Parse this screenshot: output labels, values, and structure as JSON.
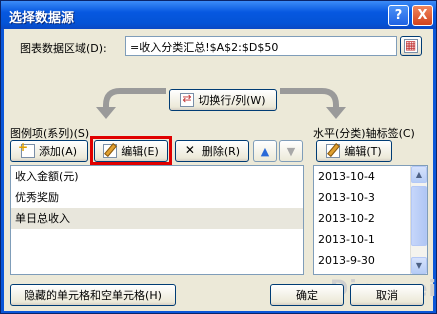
{
  "window": {
    "title": "选择数据源",
    "help_label": "?",
    "close_label": "X"
  },
  "range": {
    "label": "图表数据区域(D):",
    "value": "=收入分类汇总!$A$2:$D$50"
  },
  "switch_button": "切换行/列(W)",
  "series": {
    "label": "图例项(系列)(S)",
    "add_label": "添加(A)",
    "edit_label": "编辑(E)",
    "delete_label": "删除(R)",
    "up_label": "▲",
    "down_label": "▼",
    "items": [
      "收入金额(元)",
      "优秀奖励",
      "单日总收入"
    ]
  },
  "axis": {
    "label": "水平(分类)轴标签(C)",
    "edit_label": "编辑(T)",
    "items": [
      "2013-10-4",
      "2013-10-3",
      "2013-10-2",
      "2013-10-1",
      "2013-9-30"
    ]
  },
  "footer": {
    "hidden_cells_label": "隐藏的单元格和空单元格(H)",
    "ok_label": "确定",
    "cancel_label": "取消"
  },
  "watermark": "Dingwei"
}
